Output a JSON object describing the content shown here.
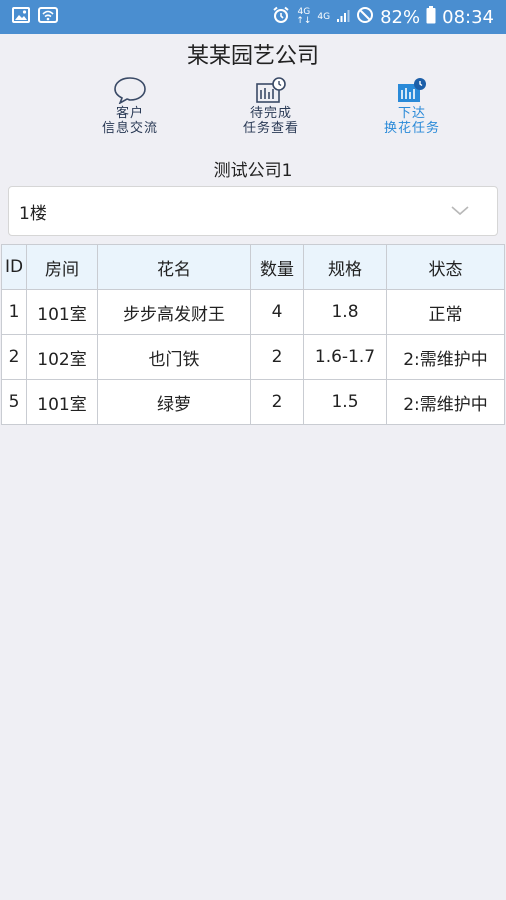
{
  "status_bar": {
    "icons_left": [
      "image-icon",
      "wifi-icon"
    ],
    "network_top": "4G",
    "network_bottom": "4G",
    "battery": "82%",
    "time": "08:34"
  },
  "app": {
    "title": "某某园艺公司"
  },
  "toolbar": {
    "items": [
      {
        "line1": "客户",
        "line2": "信息交流",
        "icon": "chat-bubble-icon",
        "active": false
      },
      {
        "line1": "待完成",
        "line2": "任务查看",
        "icon": "task-list-icon",
        "active": false
      },
      {
        "line1": "下达",
        "line2": "换花任务",
        "icon": "dispatch-task-icon",
        "active": true
      }
    ]
  },
  "company": {
    "name": "测试公司1"
  },
  "floor_select": {
    "value": "1楼"
  },
  "table": {
    "headers": [
      "ID",
      "房间",
      "花名",
      "数量",
      "规格",
      "状态"
    ],
    "rows": [
      [
        "1",
        "101室",
        "步步高发财王",
        "4",
        "1.8",
        "正常"
      ],
      [
        "2",
        "102室",
        "也门铁",
        "2",
        "1.6-1.7",
        "2:需维护中"
      ],
      [
        "5",
        "101室",
        "绿萝",
        "2",
        "1.5",
        "2:需维护中"
      ]
    ]
  },
  "colors": {
    "status_bar": "#4a8ed0",
    "accent": "#2a8ad8",
    "header_bg": "#eaf4fc",
    "page_bg": "#efeff4"
  }
}
